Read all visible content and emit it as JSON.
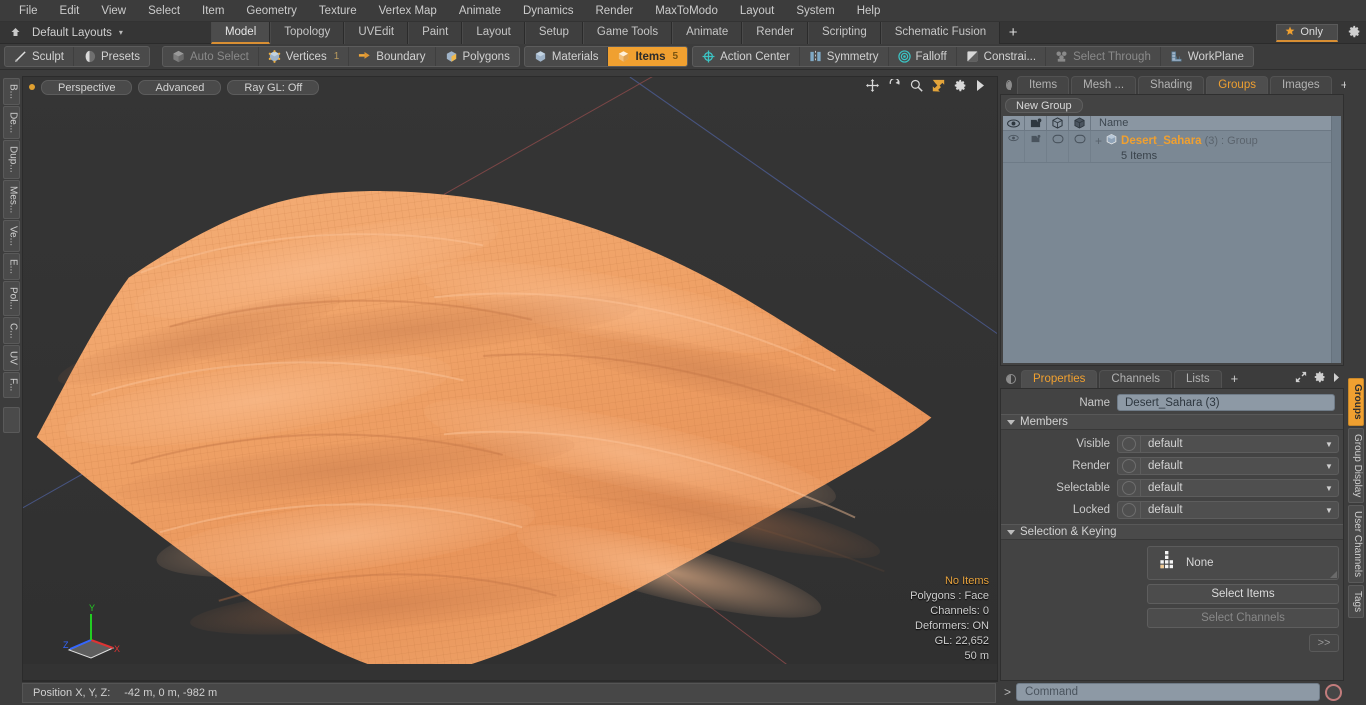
{
  "menubar": {
    "items": [
      "File",
      "Edit",
      "View",
      "Select",
      "Item",
      "Geometry",
      "Texture",
      "Vertex Map",
      "Animate",
      "Dynamics",
      "Render",
      "MaxToModo",
      "Layout",
      "System",
      "Help"
    ]
  },
  "layoutbar": {
    "layout_name": "Default Layouts",
    "caret": "▾",
    "tabs": [
      {
        "label": "Model",
        "active": true
      },
      {
        "label": "Topology",
        "active": false
      },
      {
        "label": "UVEdit",
        "active": false
      },
      {
        "label": "Paint",
        "active": false
      },
      {
        "label": "Layout",
        "active": false
      },
      {
        "label": "Setup",
        "active": false
      },
      {
        "label": "Game Tools",
        "active": false
      },
      {
        "label": "Animate",
        "active": false
      },
      {
        "label": "Render",
        "active": false
      },
      {
        "label": "Scripting",
        "active": false
      },
      {
        "label": "Schematic Fusion",
        "active": false
      }
    ],
    "add_tab": "+",
    "only_label": "Only",
    "star_icon": "star-icon",
    "gear_icon": "gear-icon"
  },
  "toolbar": {
    "group_left": [
      {
        "label": "Sculpt",
        "icon": "sculpt-icon",
        "state": "normal"
      },
      {
        "label": "Presets",
        "icon": "presets-icon",
        "state": "normal"
      }
    ],
    "group_selection": [
      {
        "label": "Auto Select",
        "icon": "cube-icon",
        "state": "dim",
        "count": ""
      },
      {
        "label": "Vertices",
        "icon": "vertices-icon",
        "state": "normal",
        "count": "1"
      },
      {
        "label": "Boundary",
        "icon": "boundary-icon",
        "state": "normal",
        "count": ""
      },
      {
        "label": "Polygons",
        "icon": "polygons-icon",
        "state": "normal",
        "count": ""
      }
    ],
    "group_items": [
      {
        "label": "Materials",
        "icon": "materials-icon",
        "state": "normal",
        "count": ""
      },
      {
        "label": "Items",
        "icon": "items-icon",
        "state": "selected",
        "count": "5"
      }
    ],
    "group_modifiers": [
      {
        "label": "Action Center",
        "icon": "action-center-icon",
        "state": "normal"
      },
      {
        "label": "Symmetry",
        "icon": "symmetry-icon",
        "state": "normal"
      },
      {
        "label": "Falloff",
        "icon": "falloff-icon",
        "state": "normal"
      },
      {
        "label": "Constrai...",
        "icon": "constraint-icon",
        "state": "normal"
      },
      {
        "label": "Select Through",
        "icon": "select-through-icon",
        "state": "dim"
      },
      {
        "label": "WorkPlane",
        "icon": "workplane-icon",
        "state": "normal"
      }
    ]
  },
  "left_tabs": [
    "B...",
    "De...",
    "Dup...",
    "Mes...",
    "Ve...",
    "E...",
    "Pol...",
    "C...",
    "UV",
    "F..."
  ],
  "viewport": {
    "buttons": [
      "Perspective",
      "Advanced",
      "Ray GL: Off"
    ],
    "header_icons": [
      "pan-icon",
      "rotate-icon",
      "zoom-icon",
      "fit-icon",
      "gear-icon",
      "chevron-right-icon"
    ],
    "stats": {
      "items": "No Items",
      "polygons": "Polygons : Face",
      "channels": "Channels: 0",
      "deformers": "Deformers: ON",
      "gl": "GL: 22,652",
      "scale": "50 m"
    },
    "axis_labels": {
      "x": "X",
      "y": "Y",
      "z": "Z"
    },
    "terrain_color": "#ee9f63",
    "background_color": "#333333",
    "accent_color": "#f0a030"
  },
  "statusbar": {
    "position_label": "Position X, Y, Z:",
    "position_value": "-42 m, 0 m, -982 m"
  },
  "groups_panel": {
    "tabs": [
      {
        "label": "Items",
        "active": false
      },
      {
        "label": "Mesh ...",
        "active": false
      },
      {
        "label": "Shading",
        "active": false
      },
      {
        "label": "Groups",
        "active": true
      },
      {
        "label": "Images",
        "active": false
      }
    ],
    "add_tab": "+",
    "new_group_button": "New Group",
    "list_header": {
      "col_icons": [
        "eye-icon",
        "render-icon",
        "wire-cube-icon",
        "shaded-cube-icon"
      ],
      "name": "Name"
    },
    "rows": [
      {
        "expand": "+",
        "name": "Desert_Sahara",
        "count": "(3)",
        "type": ": Group",
        "sub": "5 Items",
        "icon": "group-cube-icon"
      }
    ]
  },
  "properties_panel": {
    "tabs": [
      {
        "label": "Properties",
        "active": true
      },
      {
        "label": "Channels",
        "active": false
      },
      {
        "label": "Lists",
        "active": false
      }
    ],
    "add_tab": "+",
    "name_label": "Name",
    "name_value": "Desert_Sahara (3)",
    "members_section": "Members",
    "members_rows": [
      {
        "label": "Visible",
        "value": "default"
      },
      {
        "label": "Render",
        "value": "default"
      },
      {
        "label": "Selectable",
        "value": "default"
      },
      {
        "label": "Locked",
        "value": "default"
      }
    ],
    "selection_section": "Selection & Keying",
    "selection_set_value": "None",
    "select_items_button": "Select Items",
    "select_channels_button": "Select Channels",
    "more_button": ">>"
  },
  "right_tabs": [
    {
      "label": "Groups",
      "active": true
    },
    {
      "label": "Group Display",
      "active": false
    },
    {
      "label": "User Channels",
      "active": false
    },
    {
      "label": "Tags",
      "active": false
    }
  ],
  "command_bar": {
    "prompt": ">",
    "placeholder": "Command",
    "record_icon": "record-icon"
  }
}
